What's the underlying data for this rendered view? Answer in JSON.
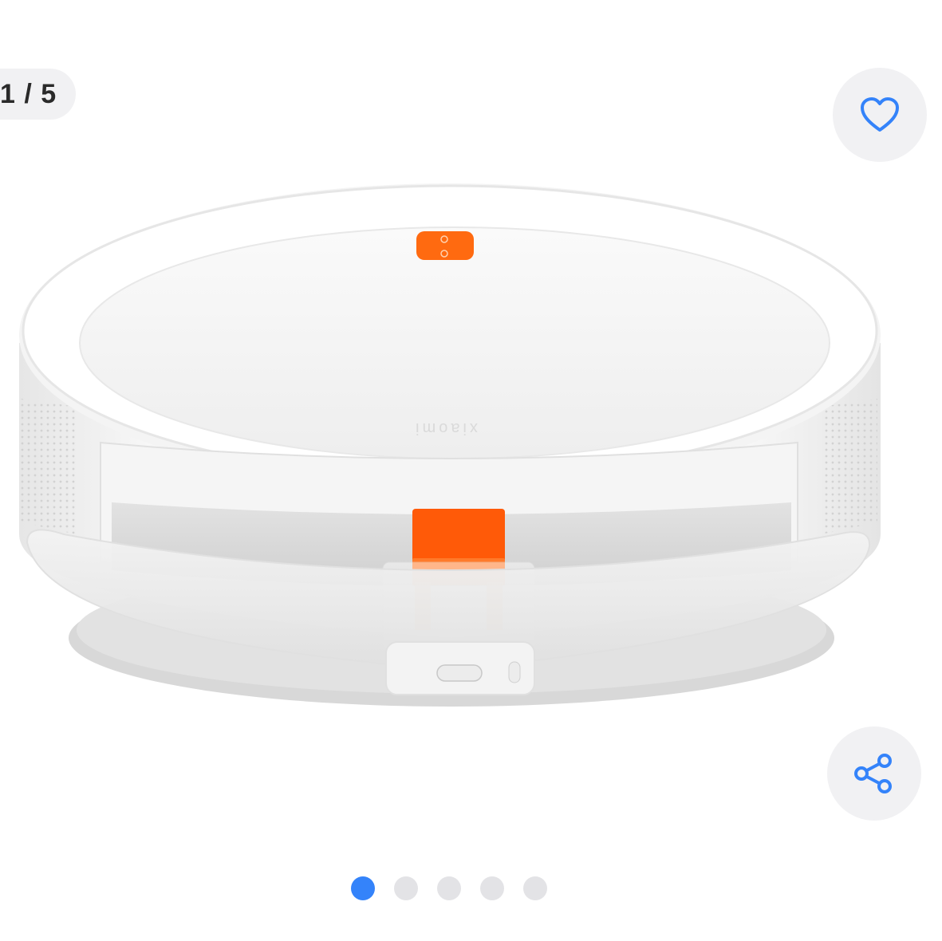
{
  "gallery": {
    "counter": "1 / 5",
    "current_index": 1,
    "total_images": 5,
    "favorite_icon": "heart-icon",
    "share_icon": "share-icon",
    "product_logo_text": "xiaomi",
    "dots_count": 5,
    "active_dot": 0
  },
  "colors": {
    "accent": "#3483fa",
    "button_bg": "#f1f1f3",
    "dot_inactive": "#e3e3e6",
    "product_orange": "#ff6a10"
  }
}
